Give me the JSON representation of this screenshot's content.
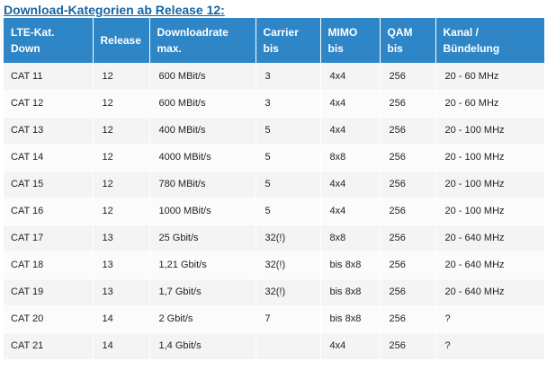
{
  "page": {
    "heading": "Download-Kategorien ab Release 12:"
  },
  "table": {
    "headers": [
      [
        "LTE-Kat.",
        "Down"
      ],
      [
        "Release"
      ],
      [
        "Downloadrate",
        "max."
      ],
      [
        "Carrier",
        "bis"
      ],
      [
        "MIMO",
        "bis"
      ],
      [
        "QAM",
        "bis"
      ],
      [
        "Kanal /",
        "Bündelung"
      ]
    ],
    "rows": [
      [
        "CAT 11",
        "12",
        "600 MBit/s",
        "3",
        "4x4",
        "256",
        "20 - 60 MHz"
      ],
      [
        "CAT 12",
        "12",
        "600 MBit/s",
        "3",
        "4x4",
        "256",
        "20 - 60 MHz"
      ],
      [
        "CAT 13",
        "12",
        "400 MBit/s",
        "5",
        "4x4",
        "256",
        "20 - 100 MHz"
      ],
      [
        "CAT 14",
        "12",
        "4000 MBit/s",
        "5",
        "8x8",
        "256",
        "20 - 100 MHz"
      ],
      [
        "CAT 15",
        "12",
        "780 MBit/s",
        "5",
        "4x4",
        "256",
        "20 - 100 MHz"
      ],
      [
        "CAT 16",
        "12",
        "1000 MBit/s",
        "5",
        "4x4",
        "256",
        "20 - 100 MHz"
      ],
      [
        "CAT 17",
        "13",
        "25 Gbit/s",
        "32(!)",
        "8x8",
        "256",
        "20 - 640 MHz"
      ],
      [
        "CAT 18",
        "13",
        "1,21 Gbit/s",
        "32(!)",
        "bis 8x8",
        "256",
        "20 - 640 MHz"
      ],
      [
        "CAT 19",
        "13",
        "1,7 Gbit/s",
        "32(!)",
        "bis 8x8",
        "256",
        "20 - 640 MHz"
      ],
      [
        "CAT 20",
        "14",
        "2 Gbit/s",
        "7",
        "bis 8x8",
        "256",
        "?"
      ],
      [
        "CAT 21",
        "14",
        "1,4 Gbit/s",
        "",
        "4x4",
        "256",
        "?"
      ]
    ]
  },
  "colors": {
    "heading": "#1565a3",
    "header_bg": "#2f86c6",
    "header_text": "#ffffff",
    "row_bg_odd": "#f4f4f4",
    "row_bg_even": "#fbfbfb",
    "cell_text": "#222222"
  }
}
